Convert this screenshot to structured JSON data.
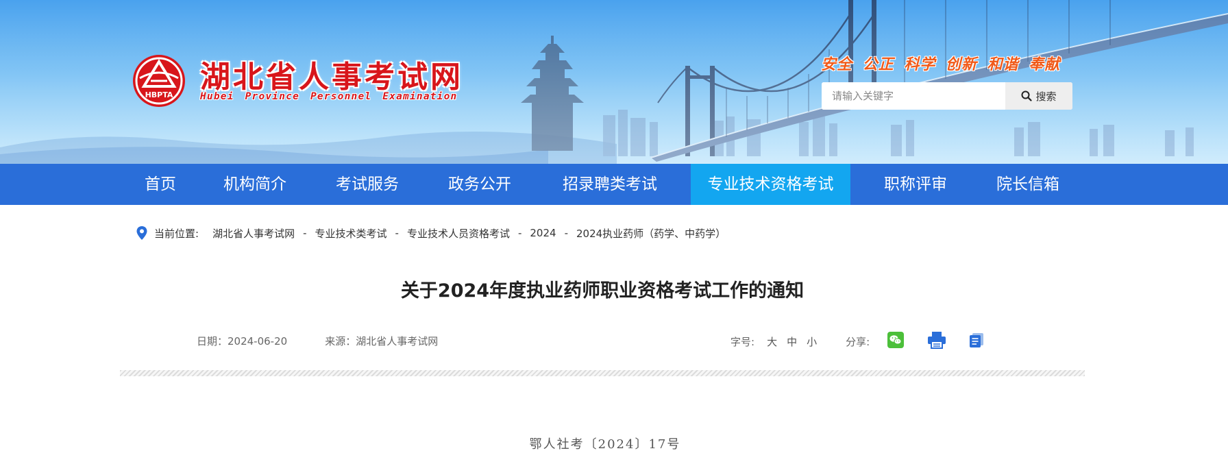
{
  "header": {
    "site_title": "湖北省人事考试网",
    "site_subtitle": "Hubei Province Personnel Examination",
    "emblem_text": "HBPTA",
    "slogan": "安全 公正 科学 创新 和谐 奉献",
    "search": {
      "placeholder": "请输入关键字",
      "button_label": "搜索"
    }
  },
  "nav": {
    "items": [
      {
        "label": "首页"
      },
      {
        "label": "机构简介"
      },
      {
        "label": "考试服务"
      },
      {
        "label": "政务公开"
      },
      {
        "label": "招录聘类考试"
      },
      {
        "label": "专业技术资格考试",
        "active": true
      },
      {
        "label": "职称评审"
      },
      {
        "label": "院长信箱"
      }
    ]
  },
  "breadcrumb": {
    "label": "当前位置:",
    "items": [
      "湖北省人事考试网",
      "专业技术类考试",
      "专业技术人员资格考试",
      "2024",
      "2024执业药师（药学、中药学）"
    ],
    "separator": "-"
  },
  "article": {
    "title": "关于2024年度执业药师职业资格考试工作的通知",
    "date": "日期：2024-06-20",
    "source": "来源：湖北省人事考试网",
    "font_size_label": "字号:",
    "font_sizes": [
      "大",
      "中",
      "小"
    ],
    "share_label": "分享:",
    "share_icons": [
      "wechat-icon",
      "print-icon",
      "copy-icon"
    ],
    "doc_number": "鄂人社考〔2024〕17号"
  },
  "colors": {
    "nav_bg": "#2a6ed9",
    "nav_active": "#13a6f0",
    "brand_red": "#d8161b",
    "slogan_orange": "#f05a1a",
    "wechat_green": "#4cbf3a",
    "print_blue": "#2a6ed9"
  }
}
